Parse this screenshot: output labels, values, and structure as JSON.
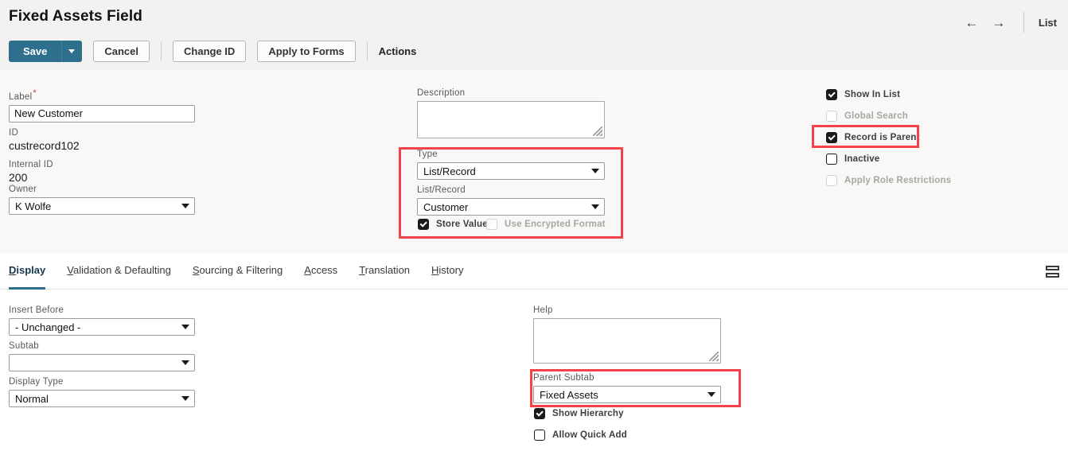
{
  "header": {
    "title": "Fixed Assets Field",
    "nav": {
      "back_icon": "arrow-left-icon",
      "forward_icon": "arrow-right-icon",
      "list_label": "List"
    }
  },
  "toolbar": {
    "save_label": "Save",
    "save_caret_icon": "chevron-down-icon",
    "cancel_label": "Cancel",
    "change_id_label": "Change ID",
    "apply_to_forms_label": "Apply to Forms",
    "actions_label": "Actions"
  },
  "form": {
    "label_field": {
      "label": "Label",
      "required": "*",
      "value": "New Customer"
    },
    "id_field": {
      "label": "ID",
      "value": "custrecord102"
    },
    "internal_id_field": {
      "label": "Internal ID",
      "value": "200"
    },
    "owner_field": {
      "label": "Owner",
      "value": "K Wolfe"
    },
    "description_field": {
      "label": "Description",
      "value": ""
    },
    "type_field": {
      "label": "Type",
      "value": "List/Record"
    },
    "list_record_field": {
      "label": "List/Record",
      "value": "Customer"
    },
    "store_value": {
      "label": "Store Value",
      "checked": true,
      "disabled": false
    },
    "use_encrypted_format": {
      "label": "Use Encrypted Format",
      "checked": false,
      "disabled": true
    },
    "checkboxes": [
      {
        "label": "Show In List",
        "checked": true,
        "disabled": false
      },
      {
        "label": "Global Search",
        "checked": false,
        "disabled": true
      },
      {
        "label": "Record is Parent",
        "checked": true,
        "disabled": false
      },
      {
        "label": "Inactive",
        "checked": false,
        "disabled": false
      },
      {
        "label": "Apply Role Restrictions",
        "checked": false,
        "disabled": true
      }
    ]
  },
  "tabs": [
    {
      "label": "Display",
      "accel": "D",
      "active": true
    },
    {
      "label": "Validation & Defaulting",
      "accel": "V",
      "active": false
    },
    {
      "label": "Sourcing & Filtering",
      "accel": "S",
      "active": false
    },
    {
      "label": "Access",
      "accel": "A",
      "active": false
    },
    {
      "label": "Translation",
      "accel": "T",
      "active": false
    },
    {
      "label": "History",
      "accel": "H",
      "active": false
    }
  ],
  "tabbar": {
    "layout_icon": "layout-rows-icon"
  },
  "display_tab": {
    "insert_before": {
      "label": "Insert Before",
      "value": "- Unchanged -"
    },
    "subtab": {
      "label": "Subtab",
      "value": ""
    },
    "display_type": {
      "label": "Display Type",
      "value": "Normal"
    },
    "help": {
      "label": "Help",
      "value": ""
    },
    "parent_subtab": {
      "label": "Parent Subtab",
      "value": "Fixed Assets"
    },
    "show_hierarchy": {
      "label": "Show Hierarchy",
      "checked": true,
      "disabled": false
    },
    "allow_quick_add": {
      "label": "Allow Quick Add",
      "checked": false,
      "disabled": false
    }
  },
  "highlights": {
    "color": "#f4424a",
    "regions": [
      "type-listrecord-group",
      "record-is-parent-checkbox",
      "parent-subtab-group"
    ]
  }
}
